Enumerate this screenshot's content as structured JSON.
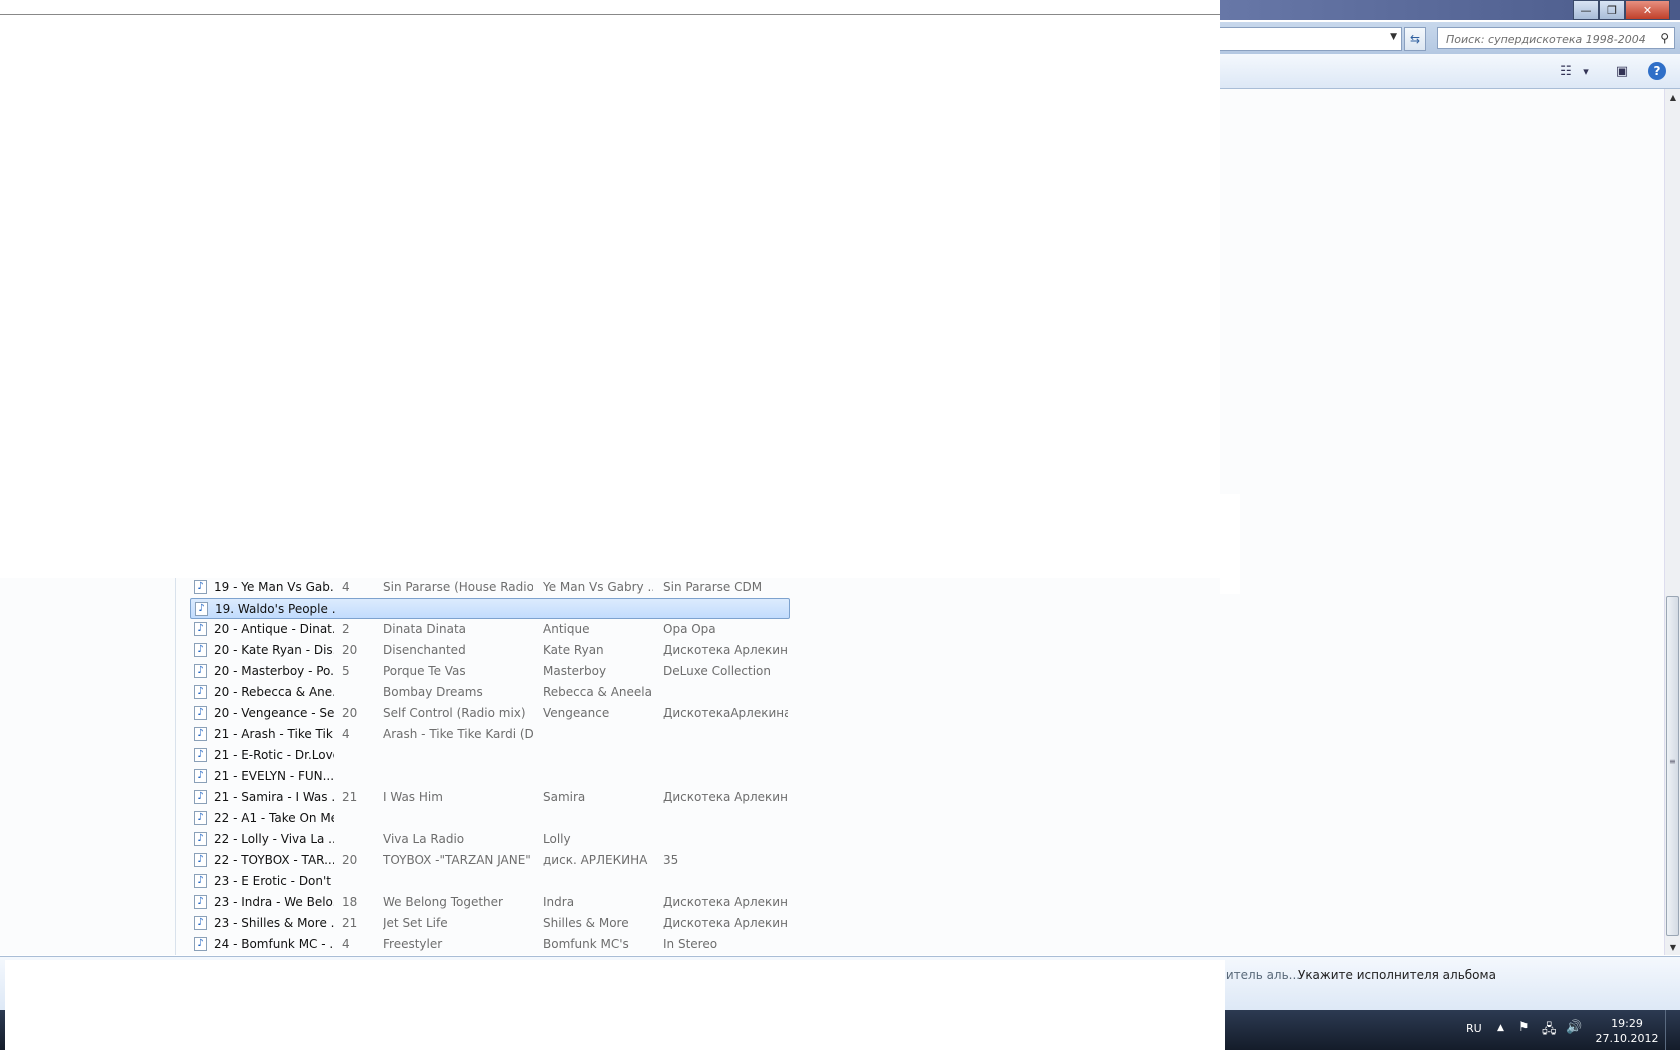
{
  "window": {
    "minimize_glyph": "—",
    "maximize_glyph": "❐",
    "close_glyph": "✕"
  },
  "address": {
    "search_placeholder": "Поиск: супердискотека 1998-2004"
  },
  "toolbar": {
    "view_glyph": "☷",
    "view_drop_glyph": "▾",
    "preview_glyph": "▣",
    "help_glyph": "?"
  },
  "files": [
    {
      "name": "19 - Ye Man Vs Gab...",
      "num": "4",
      "title": "Sin Pararse (House Radio ...",
      "artist": "Ye Man Vs Gabry ...",
      "album": "Sin Pararse CDM",
      "selected": false
    },
    {
      "name": "19. Waldo's People ...",
      "num": "",
      "title": "",
      "artist": "",
      "album": "",
      "selected": true
    },
    {
      "name": "20 - Antique - Dinat...",
      "num": "2",
      "title": "Dinata Dinata",
      "artist": "Antique",
      "album": "Opa Opa",
      "selected": false
    },
    {
      "name": "20 - Kate Ryan - Dis...",
      "num": "20",
      "title": "Disenchanted",
      "artist": "Kate Ryan",
      "album": "Дискотека Арлекин...",
      "selected": false
    },
    {
      "name": "20 - Masterboy - Po...",
      "num": "5",
      "title": "Porque Te Vas",
      "artist": "Masterboy",
      "album": "DeLuxe Collection",
      "selected": false
    },
    {
      "name": "20 - Rebecca & Ane...",
      "num": "",
      "title": "Bombay Dreams",
      "artist": "Rebecca & Aneela",
      "album": "",
      "selected": false
    },
    {
      "name": "20 - Vengeance - Se...",
      "num": "20",
      "title": "Self Control (Radio mix)",
      "artist": "Vengeance",
      "album": "ДискотекаАрлекина...",
      "selected": false
    },
    {
      "name": "21 - Arash - Tike Tik...",
      "num": "4",
      "title": "Arash - Tike Tike Kardi (DJ...",
      "artist": "",
      "album": "",
      "selected": false
    },
    {
      "name": "21 - E-Rotic - Dr.Love",
      "num": "",
      "title": "",
      "artist": "",
      "album": "",
      "selected": false
    },
    {
      "name": "21 - EVELYN - FUN...",
      "num": "",
      "title": "",
      "artist": "",
      "album": "",
      "selected": false
    },
    {
      "name": "21 - Samira - I Was ...",
      "num": "21",
      "title": "I Was Him",
      "artist": "Samira",
      "album": "Дискотека Арлекин...",
      "selected": false
    },
    {
      "name": "22 - A1 - Take On Me",
      "num": "",
      "title": "",
      "artist": "",
      "album": "",
      "selected": false
    },
    {
      "name": "22 - Lolly - Viva La ...",
      "num": "",
      "title": "Viva La Radio",
      "artist": "Lolly",
      "album": "",
      "selected": false
    },
    {
      "name": "22 - TOYBOX - TAR...",
      "num": "20",
      "title": "TOYBOX -\"TARZAN JANE\"",
      "artist": "диск. АРЛЕКИНА",
      "album": "35",
      "selected": false
    },
    {
      "name": "23 - E Erotic - Don't ...",
      "num": "",
      "title": "",
      "artist": "",
      "album": "",
      "selected": false
    },
    {
      "name": "23 - Indra - We Belo...",
      "num": "18",
      "title": "We Belong Together",
      "artist": "Indra",
      "album": "Дискотека Арлекин...",
      "selected": false
    },
    {
      "name": "23 - Shilles & More ...",
      "num": "21",
      "title": "Jet Set Life",
      "artist": "Shilles & More",
      "album": "Дискотека Арлекин...",
      "selected": false
    },
    {
      "name": "24 - Bomfunk MC - ...",
      "num": "4",
      "title": "Freestyler",
      "artist": "Bomfunk MC's",
      "album": "In Stereo",
      "selected": false
    }
  ],
  "details": {
    "label": "нитель аль...",
    "value": "Укажите исполнителя альбома"
  },
  "taskbar": {
    "lang": "RU",
    "tray_arrow": "▲",
    "flag_glyph": "⚑",
    "network_glyph": "🖧",
    "volume_glyph": "🔊",
    "time": "19:29",
    "date": "27.10.2012"
  },
  "scrollbar": {
    "up_glyph": "▲",
    "down_glyph": "▼",
    "grip_glyph": "≡"
  },
  "icons": {
    "music_file": "♪",
    "search": "⚲",
    "refresh": "⇆",
    "dropdown": "▼"
  }
}
